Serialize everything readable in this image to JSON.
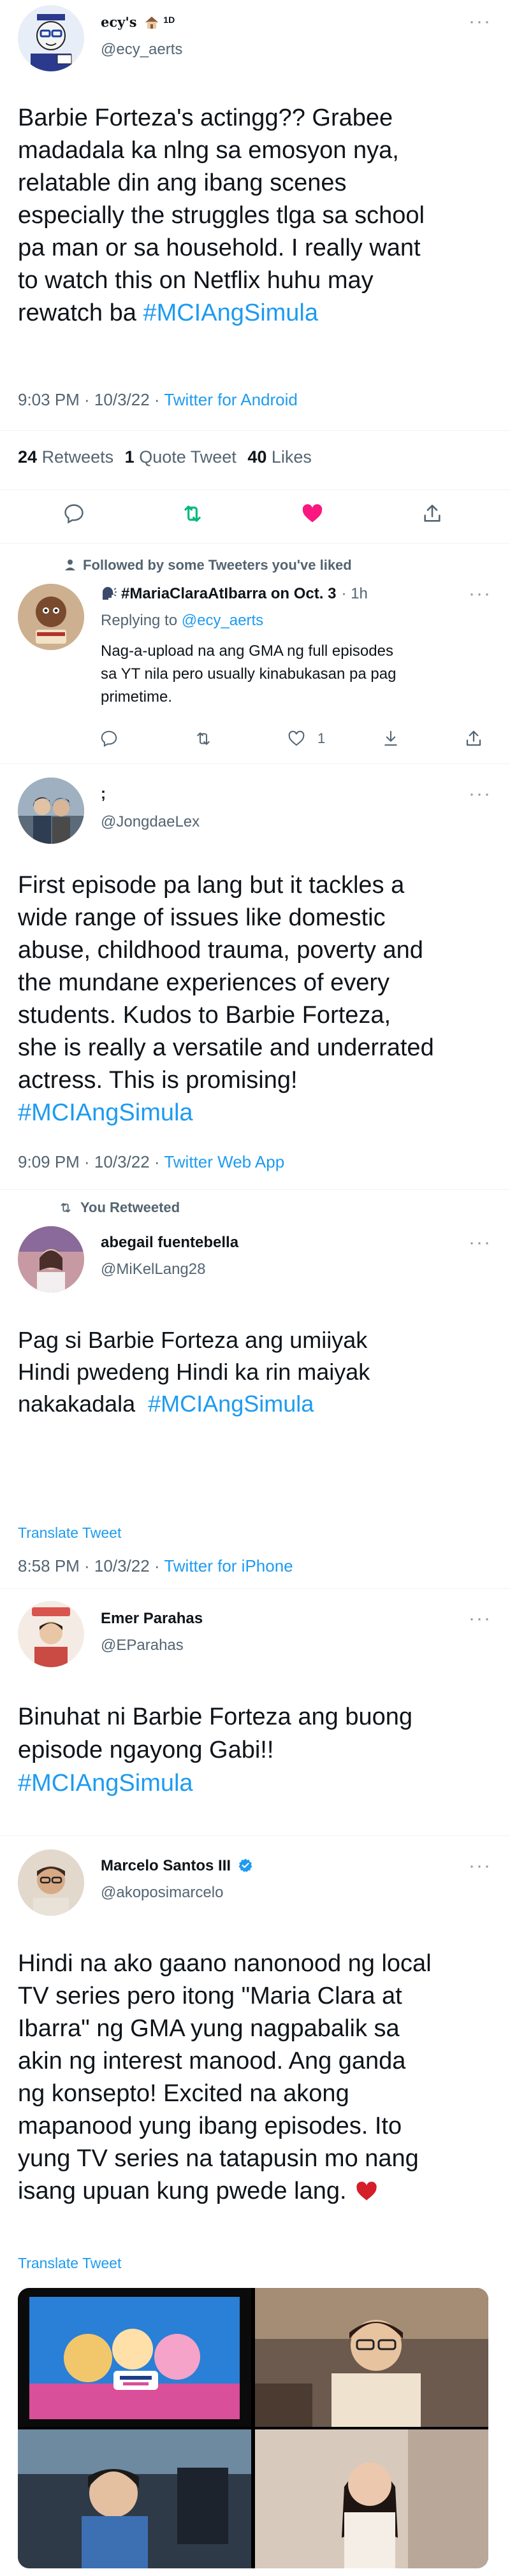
{
  "main_tweet": {
    "display_name": "ecy's",
    "display_name_suffix": "1D",
    "handle": "@ecy_aerts",
    "text_line1": "Barbie Forteza's actingg?? Grabee",
    "text_line2": "madadala ka nlng sa emosyon nya,",
    "text_line3": "relatable din ang ibang scenes",
    "text_line4": "especially the struggles tlga sa school",
    "text_line5": "pa man or sa household. I really want",
    "text_line6": "to watch this on Netflix huhu may",
    "text_line7_pre": "rewatch ba ",
    "hashtag": "#MCIAngSimula",
    "time": "9:03 PM · 10/3/22 · ",
    "client": "Twitter for Android",
    "retweets_count": "24",
    "retweets_label": "Retweets",
    "quotes_count": "1",
    "quotes_label": "Quote Tweet",
    "likes_count": "40",
    "likes_label": "Likes"
  },
  "reply1": {
    "social_context": "Followed by some Tweeters you've liked",
    "display_name": "#MariaClaraAtIbarra on Oct. 3",
    "time_ago": "· 1h",
    "replying_label": "Replying to ",
    "replying_handle": "@ecy_aerts",
    "text_line1": "Nag-a-upload na ang GMA ng full episodes",
    "text_line2": "sa YT nila pero usually kinabukasan pa pag",
    "text_line3": "primetime.",
    "like_count": "1"
  },
  "tweet2": {
    "display_name": ";",
    "handle": "@JongdaeLex",
    "text_line1": "First episode pa lang but it tackles a",
    "text_line2": "wide range of issues like domestic",
    "text_line3": "abuse, childhood trauma, poverty and",
    "text_line4": "the mundane experiences of every",
    "text_line5": "students. Kudos to Barbie Forteza,",
    "text_line6": "she is really a versatile and underrated",
    "text_line7": "actress. This is promising!",
    "hashtag": "#MCIAngSimula",
    "time": "9:09 PM · 10/3/22 · ",
    "client": "Twitter Web App"
  },
  "tweet3": {
    "social_context": "You Retweeted",
    "display_name": "abegail fuentebella",
    "handle": "@MiKelLang28",
    "text_line1": "Pag si Barbie Forteza ang umiiyak",
    "text_line2": "Hindi pwedeng Hindi ka rin maiyak",
    "text_line3_pre": "nakakadala  ",
    "hashtag": "#MCIAngSimula",
    "translate": "Translate Tweet",
    "time": "8:58 PM · 10/3/22 · ",
    "client": "Twitter for iPhone"
  },
  "tweet4": {
    "display_name": "Emer Parahas",
    "handle": "@EParahas",
    "text_line1": "Binuhat ni Barbie Forteza ang buong",
    "text_line2": "episode ngayong Gabi!!",
    "hashtag": "#MCIAngSimula"
  },
  "tweet5": {
    "display_name": "Marcelo Santos III",
    "handle": "@akoposimarcelo",
    "text_line1": "Hindi na ako gaano nanonood ng local",
    "text_line2": "TV series pero itong \"Maria Clara at",
    "text_line3": "Ibarra\" ng GMA yung nagpabalik sa",
    "text_line4": "akin ng interest manood. Ang ganda",
    "text_line5": "ng konsepto! Excited na akong",
    "text_line6": "mapanood yung ibang episodes. Ito",
    "text_line7": "yung TV series na tatapusin mo nang",
    "text_line8": "isang upuan kung pwede lang.",
    "translate": "Translate Tweet"
  },
  "colors": {
    "accent_blue": "#1d9bf0",
    "retweet_green": "#00ba7c",
    "like_pink": "#f91880",
    "text_secondary": "#536471",
    "divider": "#eff3f4"
  }
}
